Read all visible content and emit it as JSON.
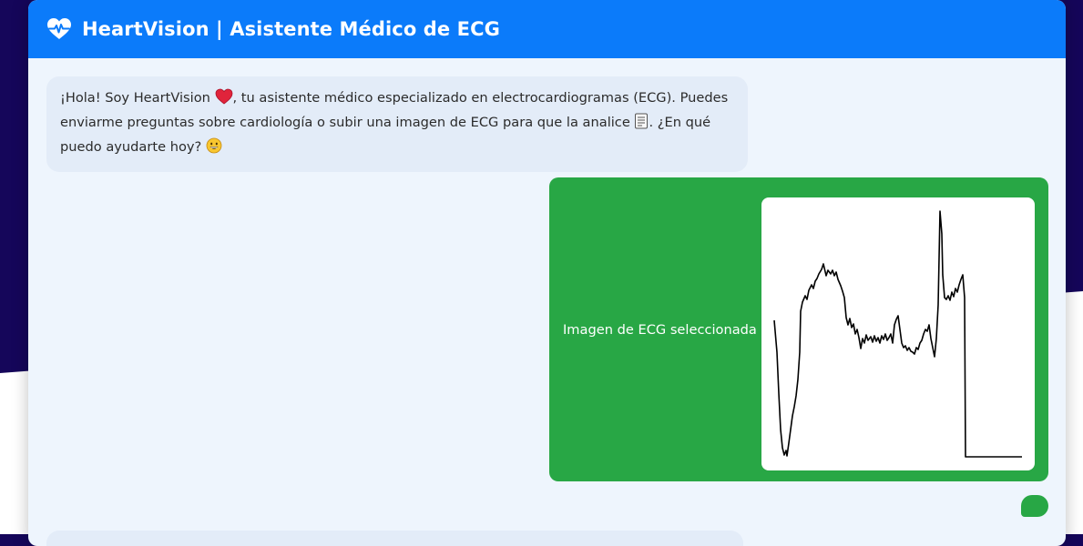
{
  "app": {
    "title": "HeartVision | Asistente Médico de ECG",
    "brand_color": "#0b7bfa",
    "user_bubble_color": "#28a745",
    "bot_bubble_color": "#e3ecf8"
  },
  "messages": {
    "bot_greeting": {
      "part1": "¡Hola! Soy HeartVision ",
      "part2": ", tu asistente médico especializado en electrocardiogramas (ECG). Puedes enviarme preguntas sobre cardiología o subir una imagen de ECG para que la analice ",
      "part3": ". ¿En qué puedo ayudarte hoy? ",
      "emojis": [
        "red-heart-icon",
        "document-icon",
        "grinning-face-icon"
      ]
    },
    "user_upload": {
      "caption": "Imagen de ECG seleccionada",
      "image": "ecg-trace-image"
    }
  }
}
